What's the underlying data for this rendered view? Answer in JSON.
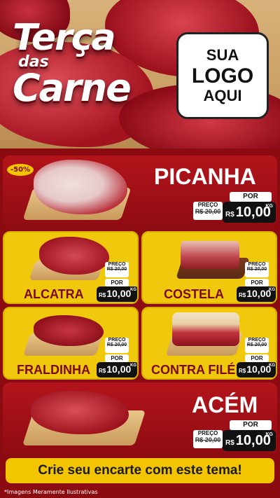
{
  "hero": {
    "title_line1": "Terça",
    "title_line2": "das",
    "title_line3": "Carne",
    "logo_line1": "SUA",
    "logo_line2": "LOGO",
    "logo_line3": "AQUI"
  },
  "products": {
    "picanha": {
      "name": "PICANHA",
      "discount": "-50%",
      "old_label": "PREÇO",
      "old_price": "R$ 20,00",
      "por_label": "POR",
      "currency": "R$",
      "price": "10,00",
      "unit": "KG"
    },
    "alcatra": {
      "name": "ALCATRA",
      "old_label": "PREÇO",
      "old_price": "R$ 20,00",
      "por_label": "POR",
      "currency": "R$",
      "price": "10,00",
      "unit": "KG"
    },
    "costela": {
      "name": "COSTELA",
      "old_label": "PREÇO",
      "old_price": "R$ 20,00",
      "por_label": "POR",
      "currency": "R$",
      "price": "10,00",
      "unit": "KG"
    },
    "fraldinha": {
      "name": "FRALDINHA",
      "old_label": "PREÇO",
      "old_price": "R$ 20,00",
      "por_label": "POR",
      "currency": "R$",
      "price": "10,00",
      "unit": "KG"
    },
    "contra_file": {
      "name": "CONTRA FILÉ",
      "old_label": "PREÇO",
      "old_price": "R$ 20,00",
      "por_label": "POR",
      "currency": "R$",
      "price": "10,00",
      "unit": "KG"
    },
    "acem": {
      "name": "ACÉM",
      "old_label": "PREÇO",
      "old_price": "R$ 20,00",
      "por_label": "POR",
      "currency": "R$",
      "price": "10,00",
      "unit": "KG"
    }
  },
  "banner": {
    "text": "Crie seu encarte com este tema!"
  },
  "disclaimer": "*Imagens Meramente Ilustrativas",
  "colors": {
    "background": "#8c0b10",
    "accent_yellow": "#f0c80c",
    "price_black": "#111111"
  }
}
